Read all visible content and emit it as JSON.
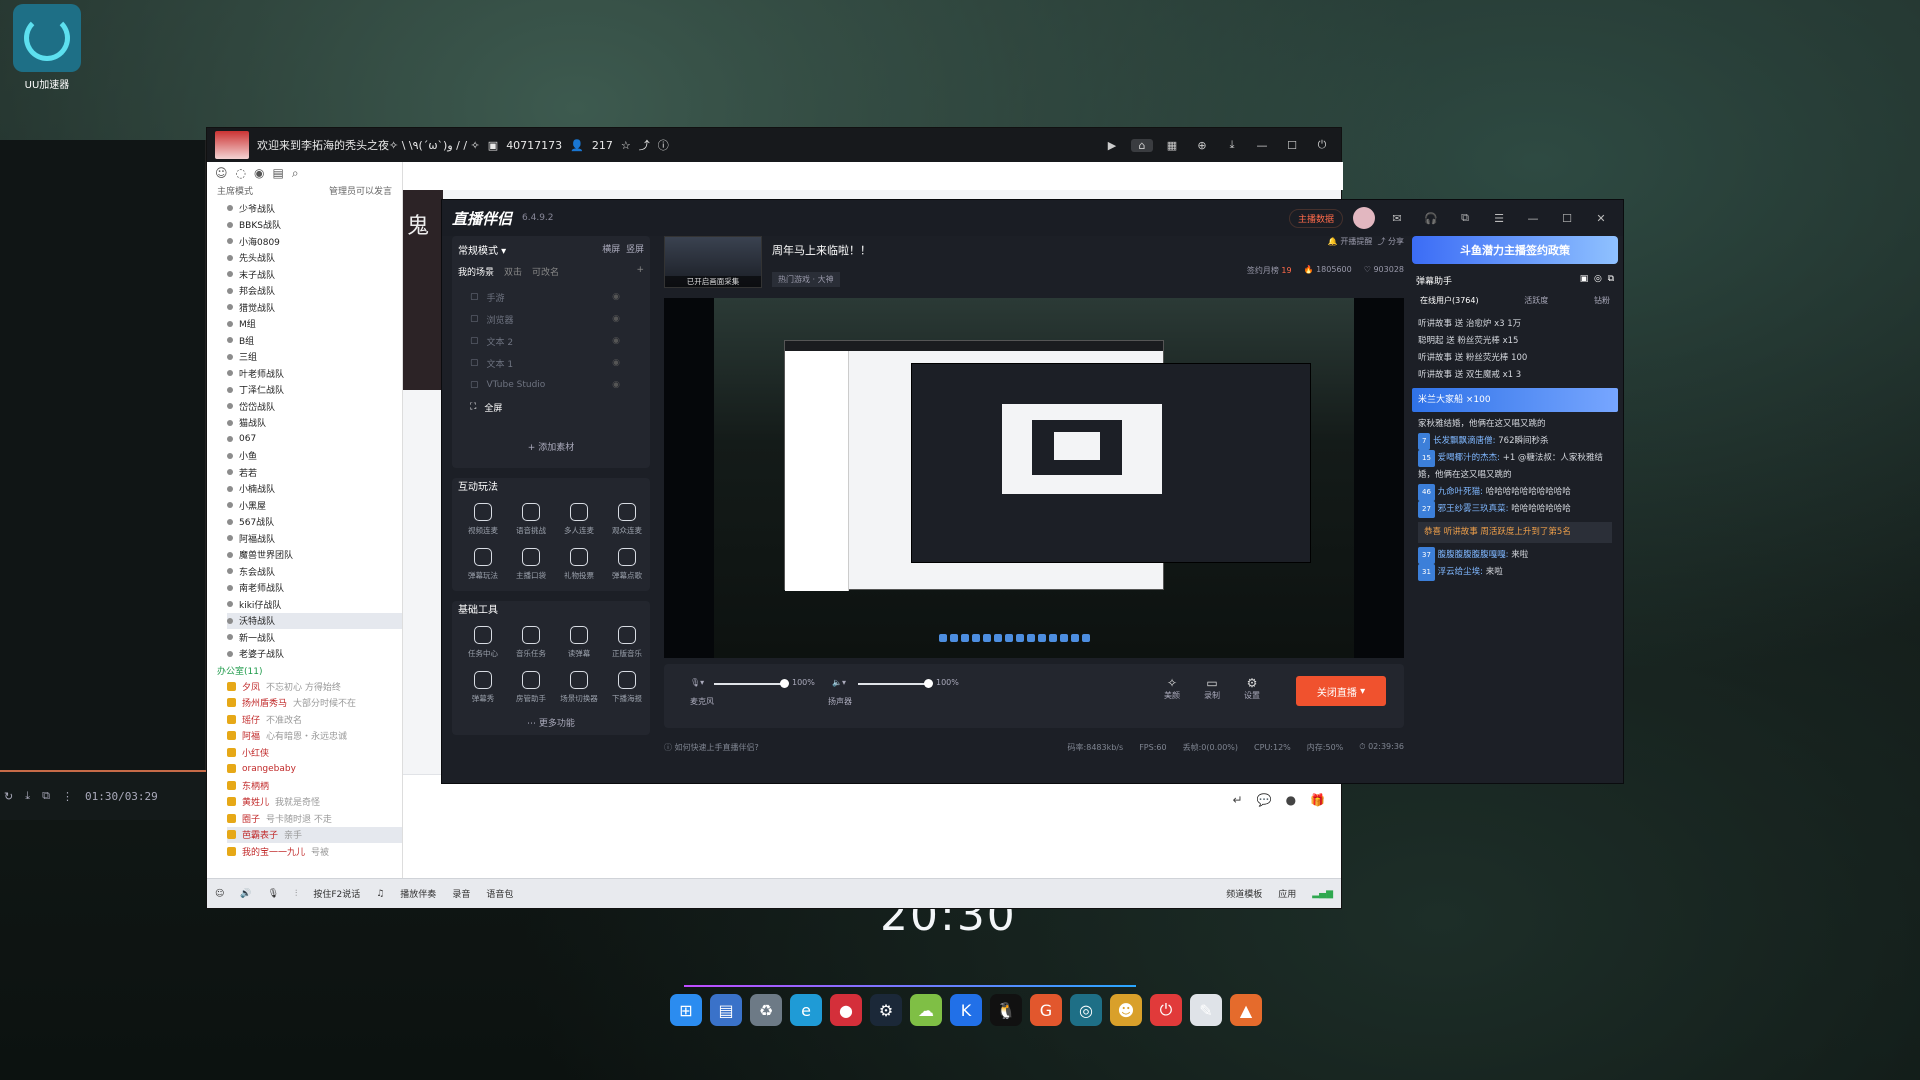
{
  "desktop": {
    "icon_label": "UU加速器",
    "clock": "20:30",
    "taskbar_icons": [
      {
        "icon": "windows-icon",
        "color": "#2b8cf0",
        "glyph": "⊞"
      },
      {
        "icon": "explorer-icon",
        "color": "#3a72c9",
        "glyph": "▤"
      },
      {
        "icon": "recycle-icon",
        "color": "#6d7a86",
        "glyph": "♻"
      },
      {
        "icon": "edge-icon",
        "color": "#1f9bd6",
        "glyph": "e"
      },
      {
        "icon": "netease-icon",
        "color": "#d42f3a",
        "glyph": "●"
      },
      {
        "icon": "steam-icon",
        "color": "#1b2838",
        "glyph": "⚙"
      },
      {
        "icon": "cloud-icon",
        "color": "#7fbf45",
        "glyph": "☁"
      },
      {
        "icon": "kugou-icon",
        "color": "#2170e8",
        "glyph": "K"
      },
      {
        "icon": "qq-icon",
        "color": "#111111",
        "glyph": "🐧"
      },
      {
        "icon": "browser-icon",
        "color": "#e2572d",
        "glyph": "G"
      },
      {
        "icon": "uu-icon",
        "color": "#1e6f86",
        "glyph": "◎"
      },
      {
        "icon": "cat-icon",
        "color": "#d9a02a",
        "glyph": "☻"
      },
      {
        "icon": "power-icon",
        "color": "#e13a3a",
        "glyph": "⏻"
      },
      {
        "icon": "notes-icon",
        "color": "#dfe3e8",
        "glyph": "✎"
      },
      {
        "icon": "fox-icon",
        "color": "#e56b2c",
        "glyph": "▲"
      }
    ]
  },
  "mini_player": {
    "time": "01:30/03:29"
  },
  "yy": {
    "title": "欢迎来到李拓海的秃头之夜✧ \\ \\٩(ˊωˋ)و / / ✧",
    "room_id": "40717173",
    "online": "217",
    "left_mode": "主席模式",
    "admin_note": "管理员可以发言",
    "channels": [
      "少爷战队",
      "BBKS战队",
      "小海0809",
      "先头战队",
      "末子战队",
      "邦会战队",
      "猎觉战队",
      "M组",
      "B组",
      "三组",
      "叶老师战队",
      "丁泽仁战队",
      "岱岱战队",
      "猫战队",
      "067",
      "小鱼",
      "若若",
      "小楠战队",
      "小黑屋",
      "567战队",
      "阿福战队",
      "魔兽世界团队",
      "东会战队",
      "南老师战队",
      "kiki仔战队",
      "沃特战队",
      "新一战队",
      "老婆子战队"
    ],
    "office_group": "办公室(11)",
    "users": [
      {
        "name": "夕凤",
        "sig": "不忘初心 方得始终"
      },
      {
        "name": "扬州盾秀马",
        "sig": "大部分时候不在"
      },
      {
        "name": "瑶仔",
        "sig": "不准改名"
      },
      {
        "name": "阿福",
        "sig": "心有暗恩・永远忠诚"
      },
      {
        "name": "小红侠",
        "sig": ""
      },
      {
        "name": "orangebaby",
        "sig": ""
      },
      {
        "name": "东柄柄",
        "sig": ""
      },
      {
        "name": "黄姓儿",
        "sig": "我就是奇怪"
      },
      {
        "name": "圈子",
        "sig": "号卡随时退 不走"
      },
      {
        "name": "芭霸表子",
        "sig": "亲手"
      },
      {
        "name": "我的宝一一九儿",
        "sig": "号被"
      }
    ],
    "bottom_bar": [
      "按住F2说话",
      "播放伴奏",
      "录音",
      "语音包"
    ],
    "bottom_right": [
      "频道模板",
      "应用"
    ]
  },
  "streamer": {
    "app_name": "直播伴侣",
    "version": "6.4.9.2",
    "anchor_btn": "主播数据",
    "mode": "常规模式",
    "orientation": [
      "横屏",
      "竖屏"
    ],
    "scene_tabs": [
      "我的场景",
      "双击",
      "可改名"
    ],
    "sources": [
      "手游",
      "浏览器",
      "文本 2",
      "文本 1",
      "VTube Studio"
    ],
    "fullscreen_source": "全屏",
    "add_material": "添加素材",
    "interactive_title": "互动玩法",
    "interactive_tools": [
      "视频连麦",
      "语音挑战",
      "多人连麦",
      "观众连麦",
      "弹幕玩法",
      "主播口袋",
      "礼物投票",
      "弹幕点歌"
    ],
    "basic_title": "基础工具",
    "basic_tools": [
      "任务中心",
      "音乐任务",
      "读弹幕",
      "正版音乐",
      "弹幕秀",
      "房管助手",
      "场景切换器",
      "下播海报"
    ],
    "more_features": "更多功能",
    "stream_title": "周年马上来临啦！！",
    "thumb_caption": "已开启画面采集",
    "category": "热门游戏 · 大神",
    "subscribe_label": "开播提醒",
    "share_label": "分享",
    "monthly_label": "签约月榜",
    "monthly_rank": "19",
    "fans": "1805600",
    "likes": "903028",
    "mic_label": "麦克风",
    "mic_volume": "100%",
    "speaker_label": "扬声器",
    "speaker_volume": "100%",
    "controls": [
      "美颜",
      "录制",
      "设置"
    ],
    "end_button": "关闭直播",
    "tip": "如何快速上手直播伴侣?",
    "status": {
      "bitrate": "码率:8483kb/s",
      "fps": "FPS:60",
      "drop": "丢帧:0(0.00%)",
      "cpu": "CPU:12%",
      "mem": "内存:50%",
      "time": "02:39:36"
    },
    "right": {
      "banner": "斗鱼潜力主播签约政策",
      "helper": "弹幕助手",
      "tabs": [
        "在线用户(3764)",
        "活跃度",
        "钻粉"
      ],
      "messages": [
        {
          "text": "听讲故事 送 治愈炉 x3 1万"
        },
        {
          "text": "聪明起 送 粉丝荧光棒 x15"
        },
        {
          "text": "听讲故事 送 粉丝荧光棒 100"
        },
        {
          "text": "听讲故事 送 双生魔戒 x1 3"
        }
      ],
      "gift_banner": "米兰大家船 ×100",
      "chat": [
        {
          "lv": "",
          "name": "",
          "text": "家秋雅结婚，他俩在这又唱又跳的"
        },
        {
          "lv": "7",
          "name": "长发飘飘滴唐僧:",
          "text": "762瞬间秒杀"
        },
        {
          "lv": "15",
          "name": "爱喝椰汁的杰杰:",
          "text": "+1 @糖法叔：人家秋雅结婚，他俩在这又唱又跳的"
        },
        {
          "lv": "46",
          "name": "九命叶死猫:",
          "text": "哈哈哈哈哈哈哈哈哈哈"
        },
        {
          "lv": "27",
          "name": "邪王纱雾三玖真菜:",
          "text": "哈哈哈哈哈哈哈"
        }
      ],
      "system": "恭喜 听讲故事 周活跃度上升到了第5名",
      "chat2": [
        {
          "lv": "37",
          "name": "腹腹腹腹腹腹嘎嘎:",
          "text": "来啦"
        },
        {
          "lv": "31",
          "name": "浮云给尘埃:",
          "text": "来啦"
        }
      ]
    }
  }
}
